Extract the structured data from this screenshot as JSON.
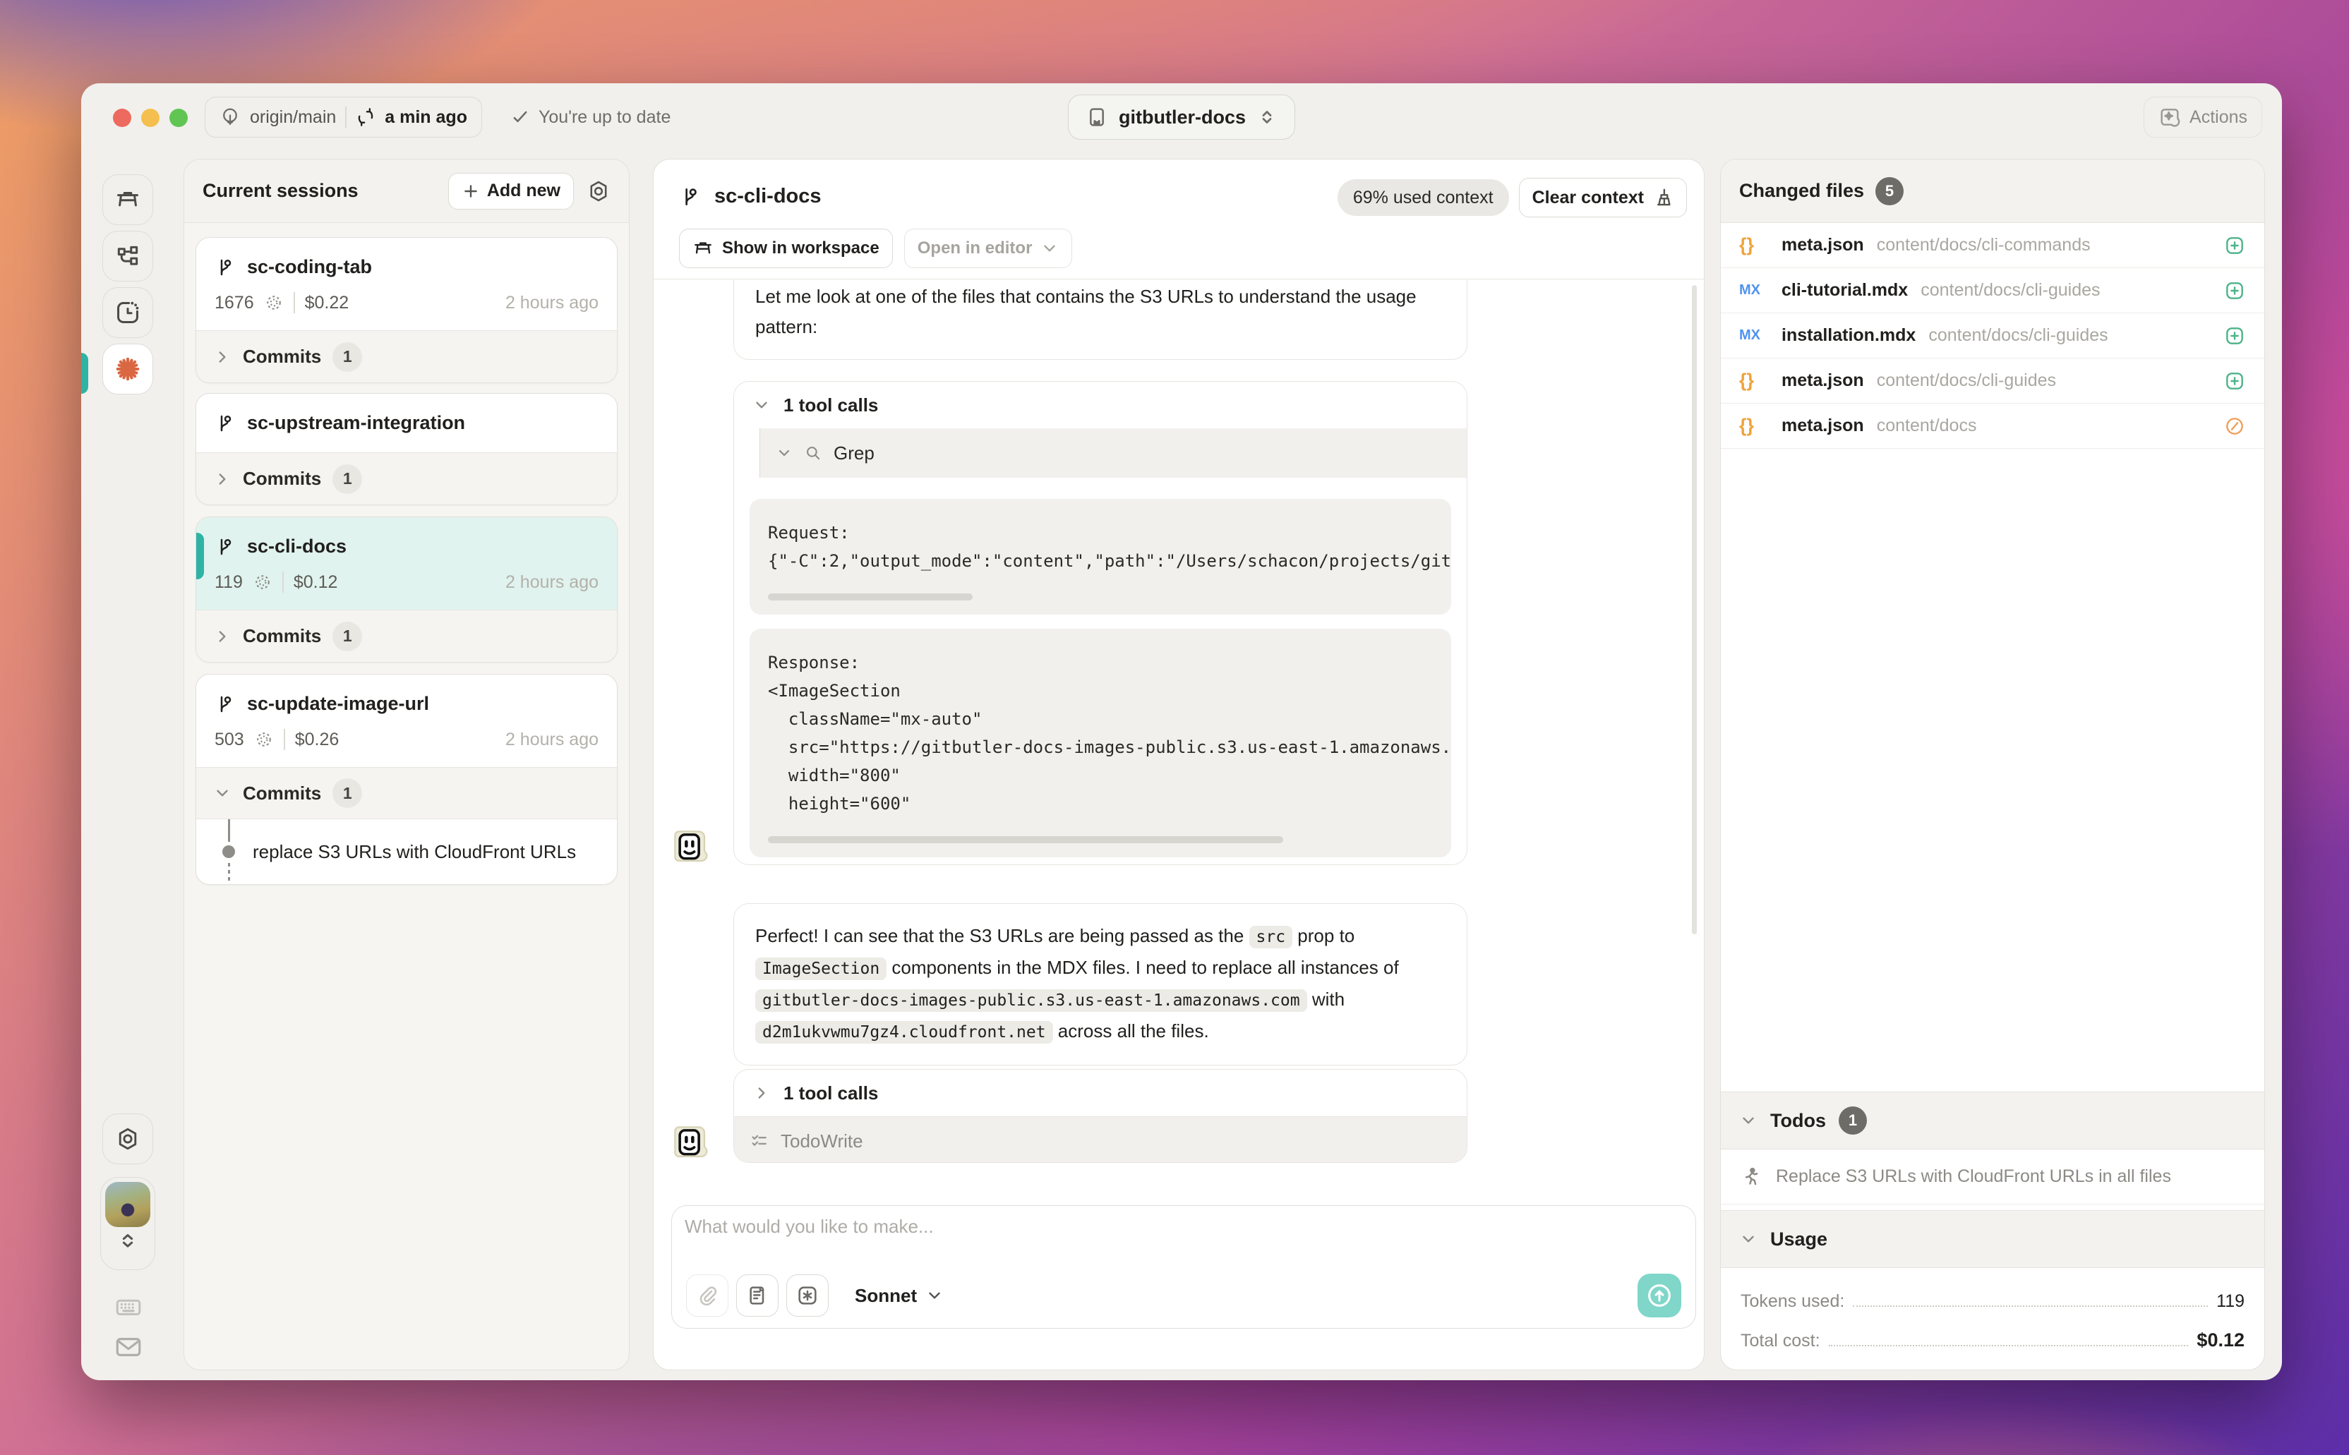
{
  "topbar": {
    "branch": "origin/main",
    "synced": "a min ago",
    "status": "You're up to date",
    "project": "gitbutler-docs",
    "actions_label": "Actions"
  },
  "sessions": {
    "title": "Current sessions",
    "add_new_label": "Add new",
    "commits_label": "Commits",
    "items": [
      {
        "name": "sc-coding-tab",
        "tokens": "1676",
        "cost": "$0.22",
        "time": "2 hours ago",
        "commits_count": "1"
      },
      {
        "name": "sc-upstream-integration",
        "commits_count": "1"
      },
      {
        "name": "sc-cli-docs",
        "tokens": "119",
        "cost": "$0.12",
        "time": "2 hours ago",
        "commits_count": "1"
      },
      {
        "name": "sc-update-image-url",
        "tokens": "503",
        "cost": "$0.26",
        "time": "2 hours ago",
        "commits_count": "1",
        "commit_message": "replace S3 URLs with CloudFront URLs"
      }
    ]
  },
  "chat": {
    "title": "sc-cli-docs",
    "context_pill": "69% used context",
    "clear_context_label": "Clear context",
    "show_in_workspace_label": "Show in workspace",
    "open_in_editor_label": "Open in editor",
    "message1": "Let me look at one of the files that contains the S3 URLs to understand the usage pattern:",
    "tool1": {
      "header": "1 tool calls",
      "name": "Grep",
      "request": [
        "Request:",
        "{\"-C\":2,\"output_mode\":\"content\",\"path\":\"/Users/schacon/projects/git"
      ],
      "response": [
        "Response:",
        "<ImageSection",
        "  className=\"mx-auto\"",
        "  src=\"https://gitbutler-docs-images-public.s3.us-east-1.amazonaws.",
        "  width=\"800\"",
        "  height=\"600\""
      ]
    },
    "message2": {
      "p1": "Perfect! I can see that the S3 URLs are being passed as the ",
      "c1": "src",
      "p2": " prop to ",
      "c2": "ImageSection",
      "p3": " components in the MDX files. I need to replace all instances of ",
      "c3": "gitbutler-docs-images-public.s3.us-east-1.amazonaws.com",
      "p4": " with ",
      "c4": "d2m1ukvwmu7gz4.cloudfront.net",
      "p5": " across all the files."
    },
    "tool2": {
      "header": "1 tool calls",
      "name": "TodoWrite"
    },
    "input": {
      "placeholder": "What would you like to make...",
      "model": "Sonnet"
    }
  },
  "changed_files": {
    "title": "Changed files",
    "count": "5",
    "items": [
      {
        "glyph": "{}",
        "name": "meta.json",
        "path": "content/docs/cli-commands",
        "status": "added"
      },
      {
        "glyph": "MX",
        "name": "cli-tutorial.mdx",
        "path": "content/docs/cli-guides",
        "status": "added"
      },
      {
        "glyph": "MX",
        "name": "installation.mdx",
        "path": "content/docs/cli-guides",
        "status": "added"
      },
      {
        "glyph": "{}",
        "name": "meta.json",
        "path": "content/docs/cli-guides",
        "status": "added"
      },
      {
        "glyph": "{}",
        "name": "meta.json",
        "path": "content/docs",
        "status": "modified"
      }
    ]
  },
  "todos": {
    "title": "Todos",
    "count": "1",
    "items": [
      {
        "text": "Replace S3 URLs with CloudFront URLs in all files"
      }
    ]
  },
  "usage": {
    "title": "Usage",
    "tokens_label": "Tokens used:",
    "tokens_value": "119",
    "cost_label": "Total cost:",
    "cost_value": "$0.12"
  },
  "colors": {
    "accent_teal": "#2fb3a4",
    "selected_session_bg": "#e1f3ef",
    "starburst_orange": "#d96742",
    "added_green": "#4db389",
    "modified_orange": "#efa05a",
    "traffic_red": "#ed6a5e",
    "traffic_yellow": "#f4bf4f",
    "traffic_green": "#61c554"
  }
}
